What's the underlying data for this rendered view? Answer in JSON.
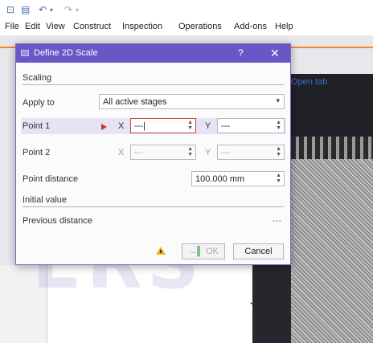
{
  "menubar": {
    "items": [
      "File",
      "Edit",
      "View",
      "Construct",
      "Inspection",
      "Operations",
      "Add-ons",
      "Help"
    ]
  },
  "background": {
    "open_tab": "Open tab",
    "watermark": "ERS"
  },
  "dialog": {
    "title": "Define 2D Scale",
    "help": "?",
    "close": "✕",
    "scaling_section": "Scaling",
    "apply_to_label": "Apply to",
    "apply_to_value": "All active stages",
    "point1_label": "Point 1",
    "point1_x_axis": "X",
    "point1_x_value": "---|",
    "point1_y_axis": "Y",
    "point1_y_value": "---",
    "point2_label": "Point 2",
    "point2_x_axis": "X",
    "point2_x_value": "---",
    "point2_y_axis": "Y",
    "point2_y_value": "---",
    "point_distance_label": "Point distance",
    "point_distance_value": "100.000 mm",
    "initial_value_section": "Initial value",
    "previous_distance_label": "Previous distance",
    "previous_distance_value": "---",
    "ok_label": "OK",
    "cancel_label": "Cancel"
  },
  "colors": {
    "title_bar": "#6a56c4",
    "accent_orange": "#f08a24",
    "active_field_border": "#c8453d",
    "warning": "#f2b314"
  }
}
